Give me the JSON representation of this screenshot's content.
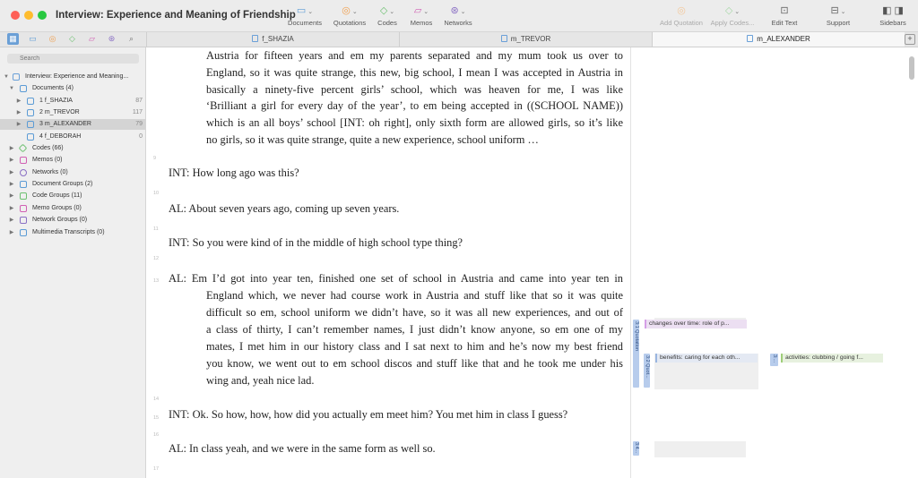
{
  "window": {
    "title": "Interview: Experience and Meaning of Friendship"
  },
  "toolbar": {
    "documents": "Documents",
    "quotations": "Quotations",
    "codes": "Codes",
    "memos": "Memos",
    "networks": "Networks",
    "add_quotation": "Add Quotation",
    "apply_codes": "Apply Codes...",
    "edit_text": "Edit Text",
    "support": "Support",
    "sidebars": "Sidebars"
  },
  "tabs": {
    "shazia": "f_SHAZIA",
    "trevor": "m_TREVOR",
    "alexander": "m_ALEXANDER"
  },
  "sidebar": {
    "search_placeholder": "Search",
    "project": "Interview: Experience and Meaning...",
    "documents": "Documents (4)",
    "doc1": {
      "label": "1 f_SHAZIA",
      "count": "87"
    },
    "doc2": {
      "label": "2 m_TREVOR",
      "count": "117"
    },
    "doc3": {
      "label": "3 m_ALEXANDER",
      "count": "79"
    },
    "doc4": {
      "label": "4 f_DEBORAH",
      "count": "0"
    },
    "codes": "Codes (66)",
    "memos": "Memos (0)",
    "networks": "Networks (0)",
    "document_groups": "Document Groups (2)",
    "code_groups": "Code Groups (11)",
    "memo_groups": "Memo Groups (0)",
    "network_groups": "Network Groups (0)",
    "multimedia": "Multimedia Transcripts (0)"
  },
  "doc": {
    "p1_l1": "Austria for fifteen years and em my parents separated and my mum took us over to",
    "p1_l2": "England, so it was quite strange, this new, big school, I mean I was accepted in Austria in",
    "p1_l3": "basically a ninety-five percent girls’ school, which was heaven for me, I was like",
    "p1_l4": "‘Brilliant a girl for every day of the year’, to em being accepted in ((SCHOOL NAME))",
    "p1_l5": "which is an all boys’ school [INT: oh right], only sixth form are allowed girls, so it’s like",
    "p1_l6": "no girls, so it was quite strange, quite a new experience, school uniform …",
    "int1": "INT:  How long ago was this?",
    "al1": "AL:  About seven years ago, coming up seven years.",
    "int2": "INT:  So you were kind of in the middle of high school type thing?",
    "al2_l1": "AL:  Em I’d got into year ten, finished one set of school in Austria and came into year ten in",
    "al2_l2": "England which, we never had course work in Austria and stuff like that so it was quite",
    "al2_l3": "difficult so em, school uniform we didn’t have, so it was all new experiences, and out of",
    "al2_l4": "a class of thirty, I can’t remember names, I just didn’t know anyone, so em one of my",
    "al2_l5": "mates, I met him in our history class and I sat next to him and he’s now my best friend",
    "al2_l6": "you know, we went out to em school discos and stuff like that and he took me under his",
    "al2_l7": "wing and, yeah nice lad.",
    "int3": "INT: Ok. So how, how, how did you actually em meet him? You met him in class I guess?",
    "al3": "AL:  In class yeah, and we were in the same form as well so.",
    "ln9": "9",
    "ln10": "10",
    "ln11": "11",
    "ln12": "12",
    "ln13": "13",
    "ln14": "14",
    "ln15": "15",
    "ln16": "16",
    "ln17": "17"
  },
  "margin": {
    "q1": "3:1 Quotation",
    "q2": "3:2 Quot...",
    "q3": "3:...",
    "q4": "3:4...",
    "code1": "changes over time: role of p...",
    "code2": "benefits: caring for each oth...",
    "code3": "activities: clubbing / going f..."
  }
}
